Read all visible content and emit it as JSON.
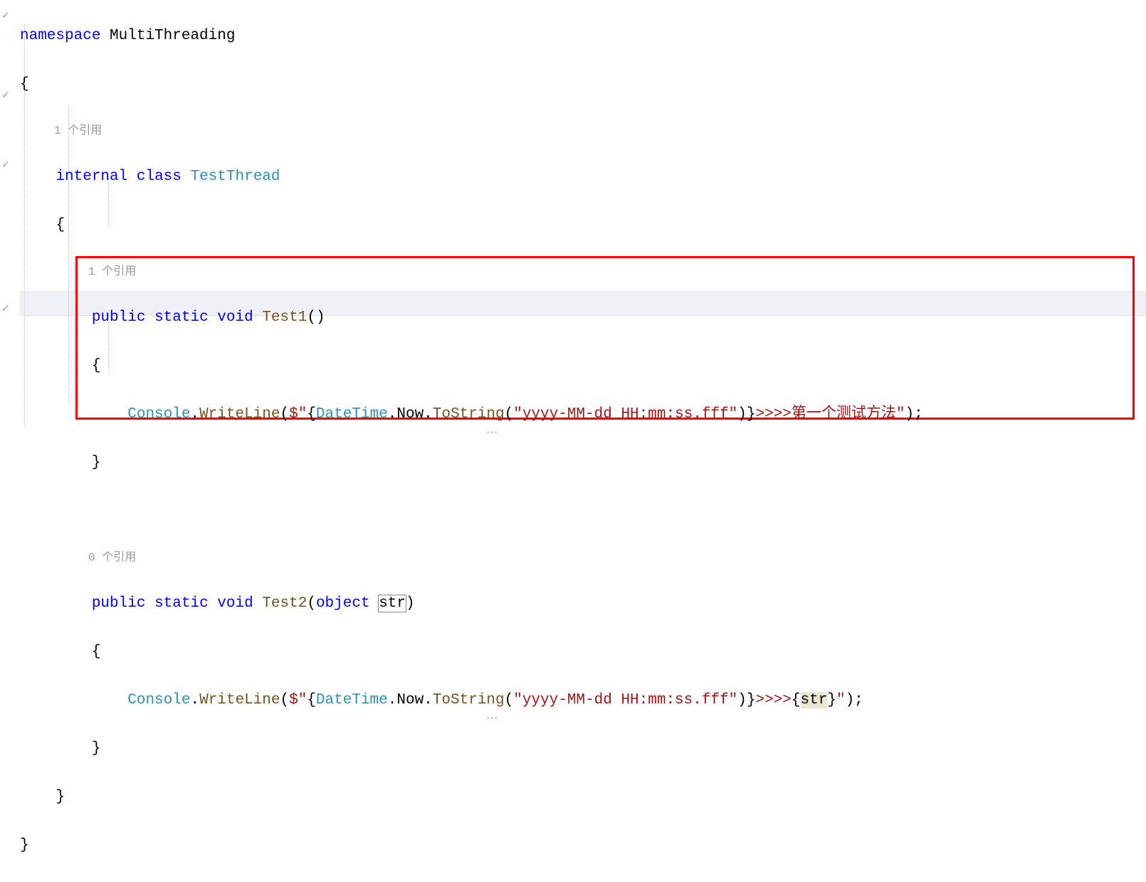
{
  "code": {
    "namespace_kw": "namespace",
    "namespace_name": "MultiThreading",
    "open_brace": "{",
    "close_brace": "}",
    "ref1": "1 个引用",
    "ref1b": "1 个引用",
    "ref0": "0 个引用",
    "internal_kw": "internal",
    "class_kw": "class",
    "class_name": "TestThread",
    "public_kw": "public",
    "static_kw": "static",
    "void_kw": "void",
    "method_test1": "Test1",
    "paren_empty": "()",
    "method_test2": "Test2",
    "paren_open": "(",
    "paren_close": ")",
    "object_kw": "object",
    "param_str": "str",
    "console": "Console",
    "dot": ".",
    "writeline": "WriteLine",
    "dollar": "$\"",
    "interp_open": "{",
    "interp_close": "}",
    "datetime": "DateTime",
    "now": "Now",
    "tostring": "ToString",
    "fmt_open": "(",
    "fmt_str": "\"yyyy-MM-dd HH:mm:ss.fff\"",
    "fmt_close": ")",
    "tail1": ">>>>第一个测试方法\"",
    "tail2_a": ">>>>",
    "tail2_b": "\"",
    "semicolon": ";",
    "interp_str_var": "str"
  }
}
